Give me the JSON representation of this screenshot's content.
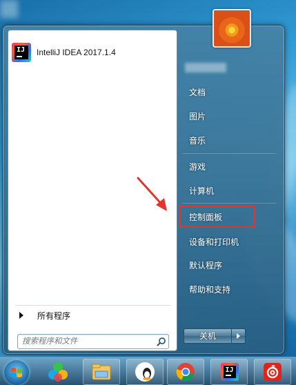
{
  "start_menu": {
    "pinned": [
      {
        "label": "IntelliJ IDEA 2017.1.4",
        "icon": "intellij-idea-icon",
        "icon_text": "IJ"
      }
    ],
    "all_programs_label": "所有程序",
    "search": {
      "placeholder": "搜索程序和文件"
    },
    "right_items": [
      {
        "label": "文档"
      },
      {
        "label": "图片"
      },
      {
        "label": "音乐"
      },
      {
        "label": "游戏"
      },
      {
        "label": "计算机"
      },
      {
        "label": "控制面板"
      },
      {
        "label": "设备和打印机"
      },
      {
        "label": "默认程序"
      },
      {
        "label": "帮助和支持"
      }
    ],
    "highlighted_item": "控制面板",
    "shutdown_label": "关机"
  },
  "taskbar": {
    "items": [
      {
        "icon": "windows-start-orb"
      },
      {
        "icon": "colorful-app-icon"
      },
      {
        "icon": "file-explorer-icon"
      },
      {
        "icon": "qq-penguin-icon"
      },
      {
        "icon": "chrome-icon"
      },
      {
        "icon": "intellij-idea-icon"
      },
      {
        "icon": "netease-music-icon"
      }
    ]
  },
  "colors": {
    "highlight_border": "#e3342f",
    "arrow": "#e3342f"
  }
}
